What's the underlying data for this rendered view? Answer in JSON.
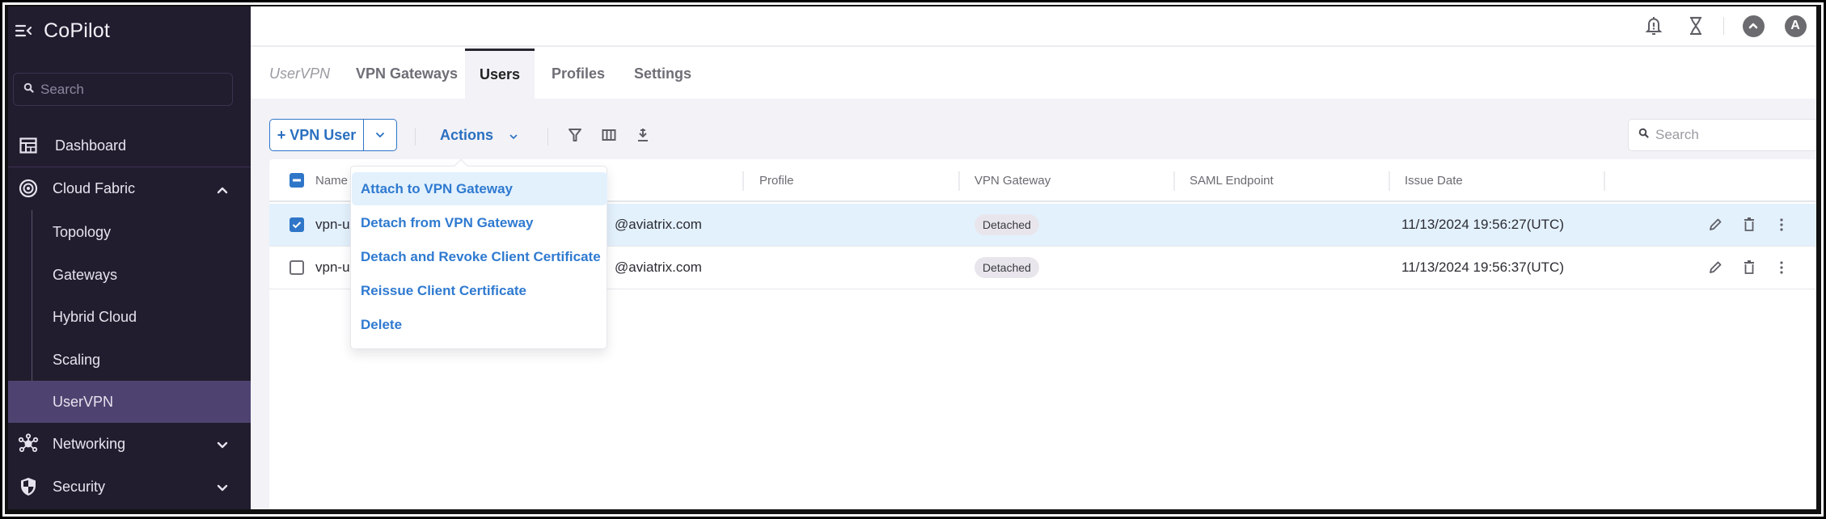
{
  "app": {
    "title": "CoPilot",
    "sidebar_search_placeholder": "Search"
  },
  "sidebar": {
    "items": [
      {
        "label": "Dashboard",
        "icon": "dashboard-icon"
      },
      {
        "label": "Cloud Fabric",
        "icon": "cloud-fabric-icon",
        "expanded": true,
        "children": [
          "Topology",
          "Gateways",
          "Hybrid Cloud",
          "Scaling",
          "UserVPN"
        ]
      },
      {
        "label": "Networking",
        "icon": "networking-icon",
        "expanded": false
      },
      {
        "label": "Security",
        "icon": "shield-icon",
        "expanded": false
      }
    ],
    "active_child": "UserVPN"
  },
  "header": {
    "icons": [
      "bell-alert-icon",
      "hourglass-icon",
      "chevron-up-circle-icon",
      "avatar"
    ],
    "avatar_initial": "A"
  },
  "tabs": {
    "breadcrumb": "UserVPN",
    "items": [
      "VPN Gateways",
      "Users",
      "Profiles",
      "Settings"
    ],
    "active": "Users"
  },
  "toolbar": {
    "add_button_label": "+ VPN User",
    "actions_label": "Actions",
    "search_placeholder": "Search",
    "icons": [
      "filter-icon",
      "columns-icon",
      "download-icon"
    ]
  },
  "table": {
    "columns": [
      "Name",
      "Profile",
      "VPN Gateway",
      "SAML Endpoint",
      "Issue Date"
    ],
    "header_checkbox": "indeterminate",
    "rows": [
      {
        "selected": true,
        "name": "vpn-u",
        "email": "@aviatrix.com",
        "profile": "",
        "vpn_gateway": "Detached",
        "saml_endpoint": "",
        "issue_date": "11/13/2024 19:56:27(UTC)"
      },
      {
        "selected": false,
        "name": "vpn-u",
        "email": "@aviatrix.com",
        "profile": "",
        "vpn_gateway": "Detached",
        "saml_endpoint": "",
        "issue_date": "11/13/2024 19:56:37(UTC)"
      }
    ]
  },
  "actions_menu": {
    "items": [
      "Attach to VPN Gateway",
      "Detach from VPN Gateway",
      "Detach and Revoke Client Certificate",
      "Reissue Client Certificate",
      "Delete"
    ],
    "highlighted": "Attach to VPN Gateway"
  },
  "colors": {
    "sidebar_bg": "#211d2e",
    "sidebar_active": "#4e4370",
    "accent": "#2f76c8",
    "selected_row": "#e3f1fd",
    "content_bg": "#f2f2f7"
  }
}
